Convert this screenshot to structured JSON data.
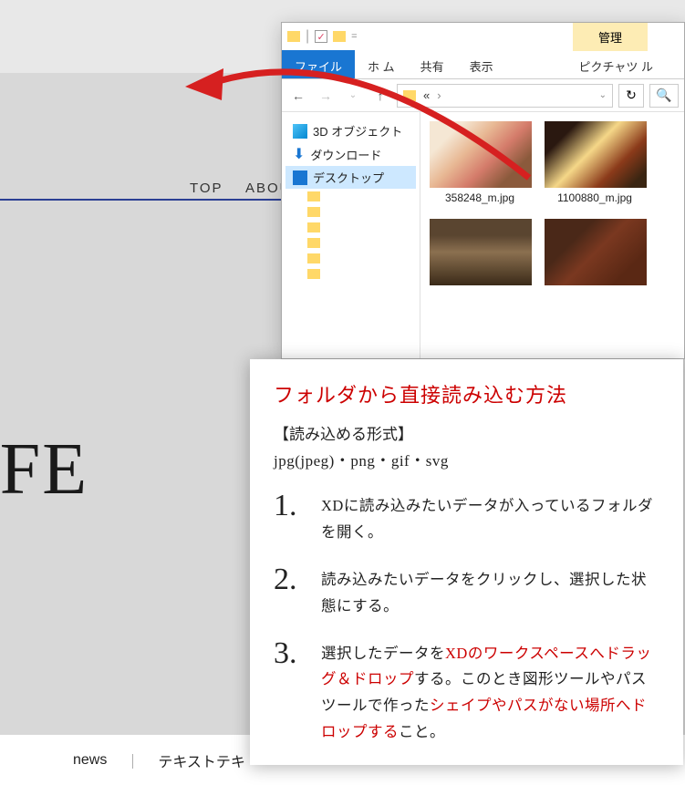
{
  "xd": {
    "nav": {
      "top": "TOP",
      "about": "ABOU"
    },
    "logo": "AFE",
    "footer": {
      "news": "news",
      "divider": "｜",
      "text": "テキストテキ"
    }
  },
  "explorer": {
    "manage": "管理",
    "tabs": {
      "file": "ファイル",
      "home": "ホ ム",
      "share": "共有",
      "view": "表示",
      "picture": "ピクチャツ  ル"
    },
    "address": {
      "sep": "«",
      "chevron": "›"
    },
    "sidebar": {
      "item3d": "3D オブジェクト",
      "download": "ダウンロード",
      "desktop": "デスクトップ"
    },
    "files": {
      "f1": "358248_m.jpg",
      "f2": "1100880_m.jpg"
    }
  },
  "instruction": {
    "title": "フォルダから直接読み込む方法",
    "subtitle": "【読み込める形式】",
    "formats": "jpg(jpeg)・png・gif・svg",
    "steps": [
      {
        "num": "1.",
        "text": "XDに読み込みたいデータが入っているフォルダを開く。"
      },
      {
        "num": "2.",
        "text": "読み込みたいデータをクリックし、選択した状態にする。"
      },
      {
        "num": "3.",
        "pre": "選択したデータを",
        "hl1": "XDのワークスペースへドラッグ＆ドロップ",
        "mid": "する。このとき図形ツールやパスツールで作った",
        "hl2": "シェイプやパスがない場所へドロップする",
        "post": "こと。"
      }
    ]
  }
}
